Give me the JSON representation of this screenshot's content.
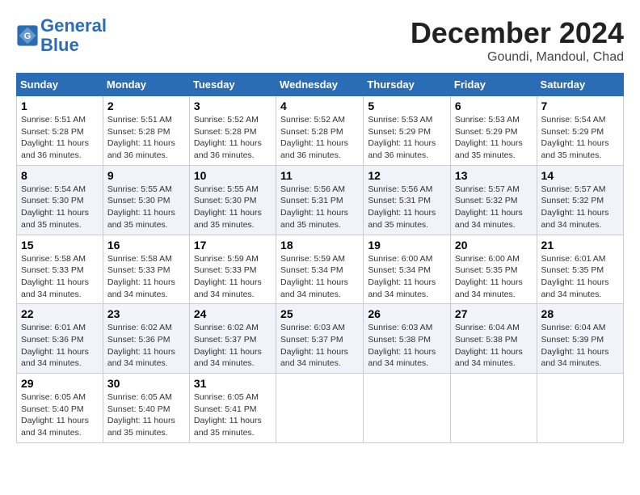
{
  "header": {
    "logo_line1": "General",
    "logo_line2": "Blue",
    "month": "December 2024",
    "location": "Goundi, Mandoul, Chad"
  },
  "weekdays": [
    "Sunday",
    "Monday",
    "Tuesday",
    "Wednesday",
    "Thursday",
    "Friday",
    "Saturday"
  ],
  "weeks": [
    [
      {
        "day": "1",
        "sunrise": "5:51 AM",
        "sunset": "5:28 PM",
        "daylight": "11 hours and 36 minutes."
      },
      {
        "day": "2",
        "sunrise": "5:51 AM",
        "sunset": "5:28 PM",
        "daylight": "11 hours and 36 minutes."
      },
      {
        "day": "3",
        "sunrise": "5:52 AM",
        "sunset": "5:28 PM",
        "daylight": "11 hours and 36 minutes."
      },
      {
        "day": "4",
        "sunrise": "5:52 AM",
        "sunset": "5:28 PM",
        "daylight": "11 hours and 36 minutes."
      },
      {
        "day": "5",
        "sunrise": "5:53 AM",
        "sunset": "5:29 PM",
        "daylight": "11 hours and 36 minutes."
      },
      {
        "day": "6",
        "sunrise": "5:53 AM",
        "sunset": "5:29 PM",
        "daylight": "11 hours and 35 minutes."
      },
      {
        "day": "7",
        "sunrise": "5:54 AM",
        "sunset": "5:29 PM",
        "daylight": "11 hours and 35 minutes."
      }
    ],
    [
      {
        "day": "8",
        "sunrise": "5:54 AM",
        "sunset": "5:30 PM",
        "daylight": "11 hours and 35 minutes."
      },
      {
        "day": "9",
        "sunrise": "5:55 AM",
        "sunset": "5:30 PM",
        "daylight": "11 hours and 35 minutes."
      },
      {
        "day": "10",
        "sunrise": "5:55 AM",
        "sunset": "5:30 PM",
        "daylight": "11 hours and 35 minutes."
      },
      {
        "day": "11",
        "sunrise": "5:56 AM",
        "sunset": "5:31 PM",
        "daylight": "11 hours and 35 minutes."
      },
      {
        "day": "12",
        "sunrise": "5:56 AM",
        "sunset": "5:31 PM",
        "daylight": "11 hours and 35 minutes."
      },
      {
        "day": "13",
        "sunrise": "5:57 AM",
        "sunset": "5:32 PM",
        "daylight": "11 hours and 34 minutes."
      },
      {
        "day": "14",
        "sunrise": "5:57 AM",
        "sunset": "5:32 PM",
        "daylight": "11 hours and 34 minutes."
      }
    ],
    [
      {
        "day": "15",
        "sunrise": "5:58 AM",
        "sunset": "5:33 PM",
        "daylight": "11 hours and 34 minutes."
      },
      {
        "day": "16",
        "sunrise": "5:58 AM",
        "sunset": "5:33 PM",
        "daylight": "11 hours and 34 minutes."
      },
      {
        "day": "17",
        "sunrise": "5:59 AM",
        "sunset": "5:33 PM",
        "daylight": "11 hours and 34 minutes."
      },
      {
        "day": "18",
        "sunrise": "5:59 AM",
        "sunset": "5:34 PM",
        "daylight": "11 hours and 34 minutes."
      },
      {
        "day": "19",
        "sunrise": "6:00 AM",
        "sunset": "5:34 PM",
        "daylight": "11 hours and 34 minutes."
      },
      {
        "day": "20",
        "sunrise": "6:00 AM",
        "sunset": "5:35 PM",
        "daylight": "11 hours and 34 minutes."
      },
      {
        "day": "21",
        "sunrise": "6:01 AM",
        "sunset": "5:35 PM",
        "daylight": "11 hours and 34 minutes."
      }
    ],
    [
      {
        "day": "22",
        "sunrise": "6:01 AM",
        "sunset": "5:36 PM",
        "daylight": "11 hours and 34 minutes."
      },
      {
        "day": "23",
        "sunrise": "6:02 AM",
        "sunset": "5:36 PM",
        "daylight": "11 hours and 34 minutes."
      },
      {
        "day": "24",
        "sunrise": "6:02 AM",
        "sunset": "5:37 PM",
        "daylight": "11 hours and 34 minutes."
      },
      {
        "day": "25",
        "sunrise": "6:03 AM",
        "sunset": "5:37 PM",
        "daylight": "11 hours and 34 minutes."
      },
      {
        "day": "26",
        "sunrise": "6:03 AM",
        "sunset": "5:38 PM",
        "daylight": "11 hours and 34 minutes."
      },
      {
        "day": "27",
        "sunrise": "6:04 AM",
        "sunset": "5:38 PM",
        "daylight": "11 hours and 34 minutes."
      },
      {
        "day": "28",
        "sunrise": "6:04 AM",
        "sunset": "5:39 PM",
        "daylight": "11 hours and 34 minutes."
      }
    ],
    [
      {
        "day": "29",
        "sunrise": "6:05 AM",
        "sunset": "5:40 PM",
        "daylight": "11 hours and 34 minutes."
      },
      {
        "day": "30",
        "sunrise": "6:05 AM",
        "sunset": "5:40 PM",
        "daylight": "11 hours and 35 minutes."
      },
      {
        "day": "31",
        "sunrise": "6:05 AM",
        "sunset": "5:41 PM",
        "daylight": "11 hours and 35 minutes."
      },
      null,
      null,
      null,
      null
    ]
  ],
  "labels": {
    "sunrise": "Sunrise:",
    "sunset": "Sunset:",
    "daylight": "Daylight:"
  }
}
